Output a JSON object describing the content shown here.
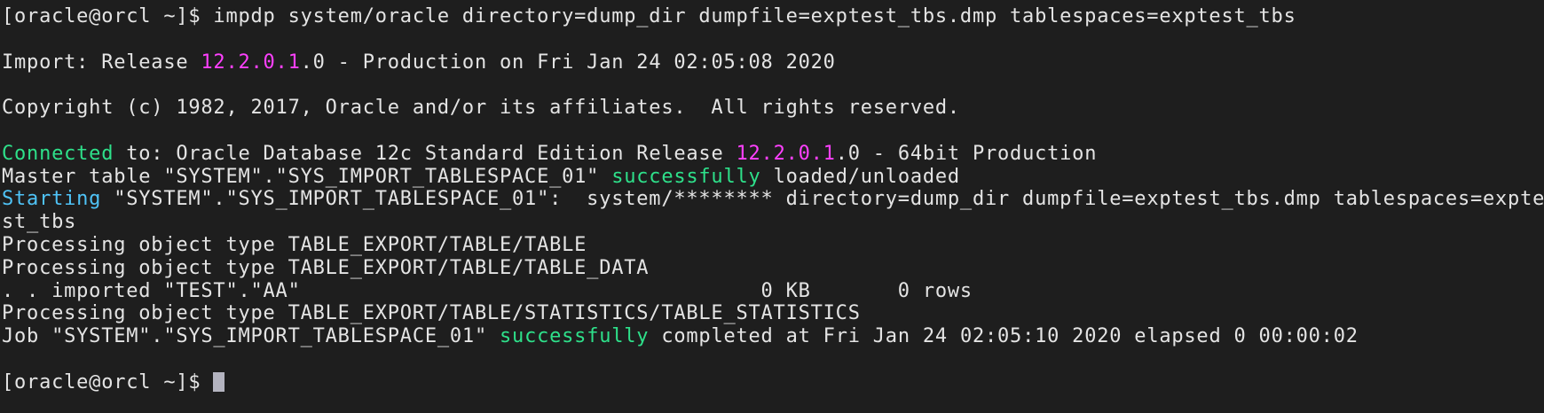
{
  "colors": {
    "background": "#1e1e1e",
    "text": "#e4e4e4",
    "version": "#ff40ff",
    "success": "#2ee08a",
    "info": "#4fc3f7",
    "cursor": "#b4b4c0"
  },
  "terminal": {
    "lines": [
      [
        {
          "t": "[oracle@orcl ~]$ impdp system/oracle directory=dump_dir dumpfile=exptest_tbs.dmp tablespaces=exptest_tbs"
        }
      ],
      [],
      [
        {
          "t": "Import: Release "
        },
        {
          "t": "12.2.0.1",
          "c": "version"
        },
        {
          "t": ".0 - Production on Fri Jan 24 02:05:08 2020"
        }
      ],
      [],
      [
        {
          "t": "Copyright (c) 1982, 2017, Oracle and/or its affiliates.  All rights reserved."
        }
      ],
      [],
      [
        {
          "t": "Connected",
          "c": "success"
        },
        {
          "t": " to: Oracle Database 12c Standard Edition Release "
        },
        {
          "t": "12.2.0.1",
          "c": "version"
        },
        {
          "t": ".0 - 64bit Production"
        }
      ],
      [
        {
          "t": "Master table \"SYSTEM\".\"SYS_IMPORT_TABLESPACE_01\" "
        },
        {
          "t": "successfully",
          "c": "success"
        },
        {
          "t": " loaded/unloaded"
        }
      ],
      [
        {
          "t": "Starting",
          "c": "info"
        },
        {
          "t": " \"SYSTEM\".\"SYS_IMPORT_TABLESPACE_01\":  system/******** directory=dump_dir dumpfile=exptest_tbs.dmp tablespaces=expte"
        }
      ],
      [
        {
          "t": "st_tbs"
        }
      ],
      [
        {
          "t": "Processing object type TABLE_EXPORT/TABLE/TABLE"
        }
      ],
      [
        {
          "t": "Processing object type TABLE_EXPORT/TABLE/TABLE_DATA"
        }
      ],
      [
        {
          "t": ". . imported \"TEST\".\"AA\"                                     0 KB       0 rows"
        }
      ],
      [
        {
          "t": "Processing object type TABLE_EXPORT/TABLE/STATISTICS/TABLE_STATISTICS"
        }
      ],
      [
        {
          "t": "Job \"SYSTEM\".\"SYS_IMPORT_TABLESPACE_01\" "
        },
        {
          "t": "successfully",
          "c": "success"
        },
        {
          "t": " completed at Fri Jan 24 02:05:10 2020 elapsed 0 00:00:02"
        }
      ],
      [],
      [
        {
          "t": "[oracle@orcl ~]$ "
        }
      ]
    ],
    "cursor_icon": "block-cursor"
  }
}
